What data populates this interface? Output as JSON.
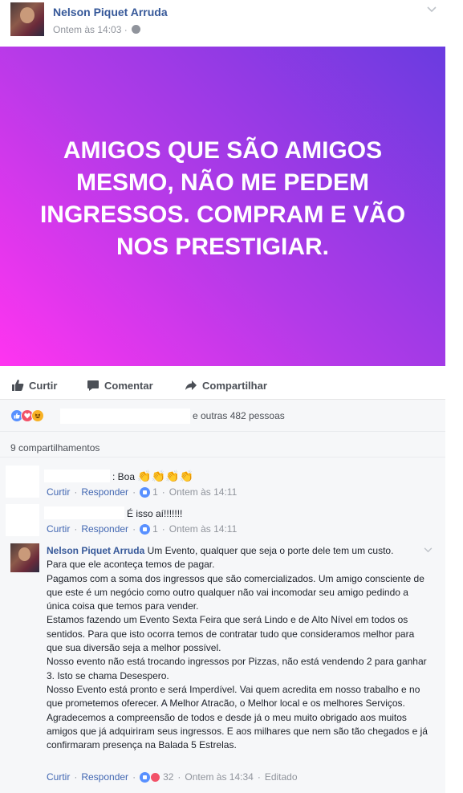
{
  "post": {
    "author": "Nelson Piquet Arruda",
    "timestamp": "Ontem às 14:03",
    "separator": "·",
    "banner_text": "AMIGOS QUE SÃO AMIGOS MESMO, NÃO ME PEDEM INGRESSOS. COMPRAM E VÃO NOS PRESTIGIAR.",
    "banner_gradient": [
      "#ff34f0",
      "#b43ae8",
      "#6a3be0"
    ]
  },
  "actions": {
    "like": "Curtir",
    "comment": "Comentar",
    "share": "Compartilhar"
  },
  "reactions": {
    "icons": [
      "like-icon",
      "love-icon",
      "haha-icon"
    ],
    "summary": "e outras 482 pessoas"
  },
  "shares": {
    "text": "9 compartilhamentos"
  },
  "comments": [
    {
      "text": ": Boa",
      "emoji": "👏👏👏👏",
      "like_label": "Curtir",
      "reply_label": "Responder",
      "reaction_count": "1",
      "time": "Ontem às 14:11"
    },
    {
      "text": "É isso aí!!!!!!!",
      "like_label": "Curtir",
      "reply_label": "Responder",
      "reaction_count": "1",
      "time": "Ontem às 14:11"
    },
    {
      "author": "Nelson Piquet Arruda",
      "lines": [
        "Um Evento, qualquer que seja o porte dele tem um custo.",
        "Para que ele aconteça temos de pagar.",
        "Pagamos com a soma dos ingressos que são comercializados. Um amigo consciente de que este é um negócio como outro qualquer não vai incomodar seu amigo pedindo a única coisa que temos para vender.",
        "Estamos fazendo um Evento Sexta Feira que será Lindo e de Alto Nível em todos os sentidos. Para que isto ocorra temos de contratar tudo que consideramos melhor para que sua diversão seja a melhor possível.",
        "Nosso evento não está trocando ingressos por Pizzas, não está vendendo 2 para ganhar 3. Isto se chama Desespero.",
        "Nosso Evento está pronto e será Imperdível. Vai quem acredita em nosso trabalho e no que prometemos oferecer. A Melhor Atracão, o Melhor local e os melhores Serviços.",
        "Agradecemos a compreensão de todos e desde já o meu muito obrigado aos muitos amigos que já adquiriram seus ingressos. E aos milhares que nem são tão chegados e já confirmaram presença na Balada 5 Estrelas."
      ],
      "like_label": "Curtir",
      "reply_label": "Responder",
      "reaction_count": "32",
      "time": "Ontem às 14:34",
      "edited": "Editado"
    }
  ],
  "colors": {
    "link": "#365899",
    "action_link": "#4267b2",
    "meta": "#90949c",
    "like_blue": "#5890ff",
    "love_red": "#f25268"
  }
}
